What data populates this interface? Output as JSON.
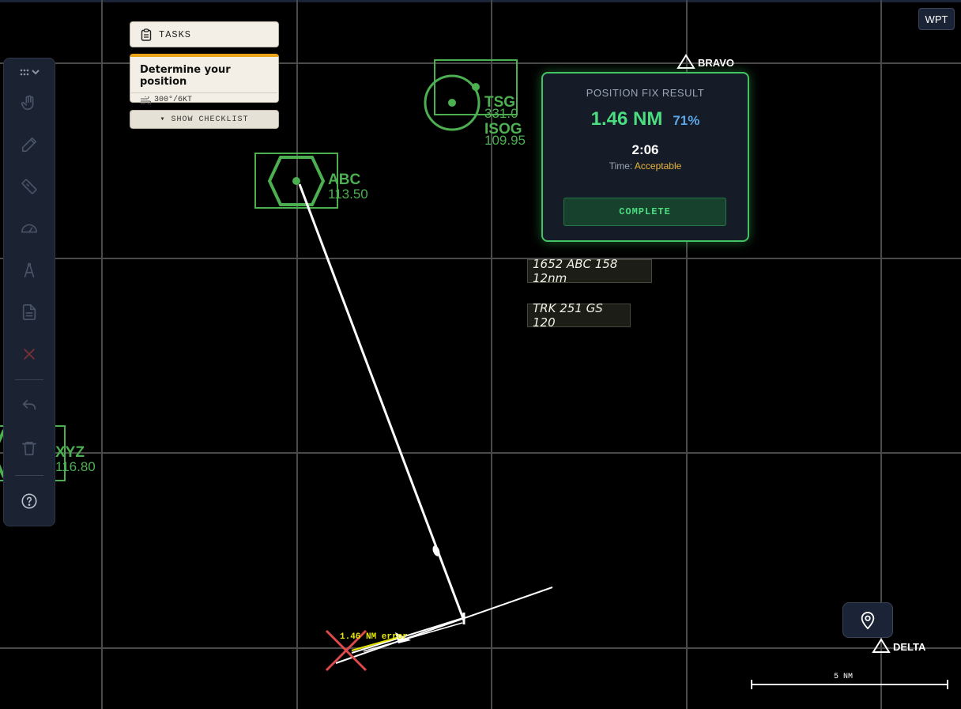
{
  "tasks": {
    "header_label": "TASKS",
    "task_title": "Determine your position",
    "wind": "300°/6KT",
    "show_checklist_label": "▾ SHOW CHECKLIST"
  },
  "wpt_button_label": "WPT",
  "navaids": [
    {
      "name": "ABC",
      "freq": "113.50",
      "type": "VOR"
    },
    {
      "name": "TSG",
      "freq": "331.0",
      "type": "NDB"
    },
    {
      "name": "ISOG",
      "freq": "109.95",
      "type": "NDB"
    },
    {
      "name": "XYZ",
      "freq": "116.80",
      "type": "VOR"
    }
  ],
  "waypoints": [
    {
      "name": "BRAVO"
    },
    {
      "name": "DELTA"
    }
  ],
  "result": {
    "title": "POSITION FIX RESULT",
    "distance": "1.46 NM",
    "score": "71%",
    "time": "2:06",
    "time_prefix": "Time:",
    "time_rating": "Acceptable",
    "complete_label": "COMPLETE"
  },
  "notes": [
    "1652 ABC 158 12nm",
    "TRK 251 GS 120"
  ],
  "error_label": "1.46 NM error",
  "scale_label": "5 NM",
  "toolbar_icons": [
    "grip-icon",
    "hand-icon",
    "pencil-icon",
    "ruler-icon",
    "protractor-icon",
    "compass-icon",
    "document-icon",
    "clear-icon",
    "undo-icon",
    "trash-icon",
    "help-icon"
  ],
  "colors": {
    "navaid": "#4caf50",
    "panel_border": "#43c463",
    "distance": "#4ade80",
    "score": "#5ba6e6",
    "time_rating": "#e8b53c",
    "error_mark": "#e04a4a",
    "error_text": "#e6e600"
  }
}
